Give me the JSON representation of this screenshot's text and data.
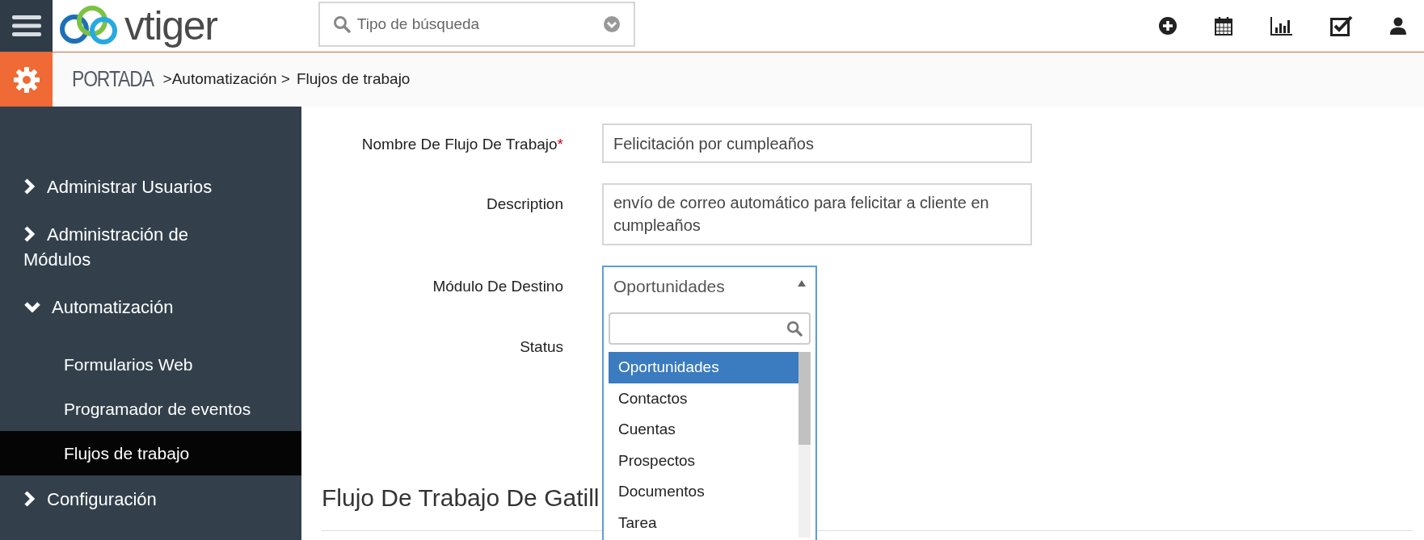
{
  "header": {
    "logo_text": "vtiger",
    "search": {
      "placeholder": "Tipo de búsqueda"
    }
  },
  "breadcrumb": {
    "home": "PORTADA",
    "items": [
      ">Automatización >",
      "Flujos de trabajo"
    ]
  },
  "sidebar": {
    "items": [
      {
        "kind": "group",
        "label": "Administrar Usuarios",
        "expanded": false
      },
      {
        "kind": "group",
        "label": "Administración de Módulos",
        "expanded": false
      },
      {
        "kind": "group",
        "label": "Automatización",
        "expanded": true
      },
      {
        "kind": "sub",
        "label": "Formularios Web",
        "selected": false
      },
      {
        "kind": "sub",
        "label": "Programador de eventos",
        "selected": false
      },
      {
        "kind": "sub",
        "label": "Flujos de trabajo",
        "selected": true
      },
      {
        "kind": "group",
        "label": "Configuración",
        "expanded": false
      }
    ]
  },
  "form": {
    "fields": [
      {
        "kind": "input",
        "label": "Nombre De Flujo De Trabajo",
        "required_mark": "*",
        "value": "Felicitación por cumpleaños"
      },
      {
        "kind": "textarea",
        "label": "Description",
        "value": "envío de correo automático para felicitar a cliente en cumpleaños"
      },
      {
        "kind": "select",
        "label": "Módulo De Destino",
        "value": "Oportunidades"
      },
      {
        "kind": "blank",
        "label": "Status"
      }
    ]
  },
  "dropdown": {
    "options": [
      {
        "label": "Oportunidades",
        "selected": true
      },
      {
        "label": "Contactos",
        "selected": false
      },
      {
        "label": "Cuentas",
        "selected": false
      },
      {
        "label": "Prospectos",
        "selected": false
      },
      {
        "label": "Documentos",
        "selected": false
      },
      {
        "label": "Tarea",
        "selected": false
      }
    ]
  },
  "section": {
    "title": "Flujo De Trabajo De Gatill"
  }
}
